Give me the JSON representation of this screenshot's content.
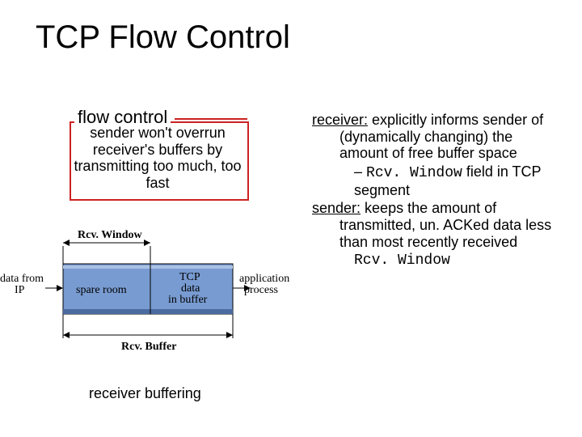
{
  "title": "TCP Flow Control",
  "flow_control": {
    "legend": "flow control",
    "body": "sender won't overrun receiver's buffers by transmitting too much, too fast"
  },
  "right": {
    "receiver_label": "receiver:",
    "receiver_text": " explicitly informs sender of (dynamically changing) the amount of free buffer space",
    "rcv_field_prefix": "– ",
    "rcv_field_code": "Rcv. Window",
    "rcv_field_suffix": "  field in TCP segment",
    "sender_label": "sender:",
    "sender_text": " keeps the amount of transmitted, un. ACKed data less than most recently received",
    "sender_code": "Rcv. Window"
  },
  "figure": {
    "rcv_window_label": "Rcv. Window",
    "rcv_buffer_label": "Rcv. Buffer",
    "data_from_ip": "data from\nIP",
    "spare_room": "spare room",
    "tcp_data_in_buffer": "TCP\ndata\nin buffer",
    "application_process": "application\nprocess",
    "caption": "receiver buffering"
  }
}
